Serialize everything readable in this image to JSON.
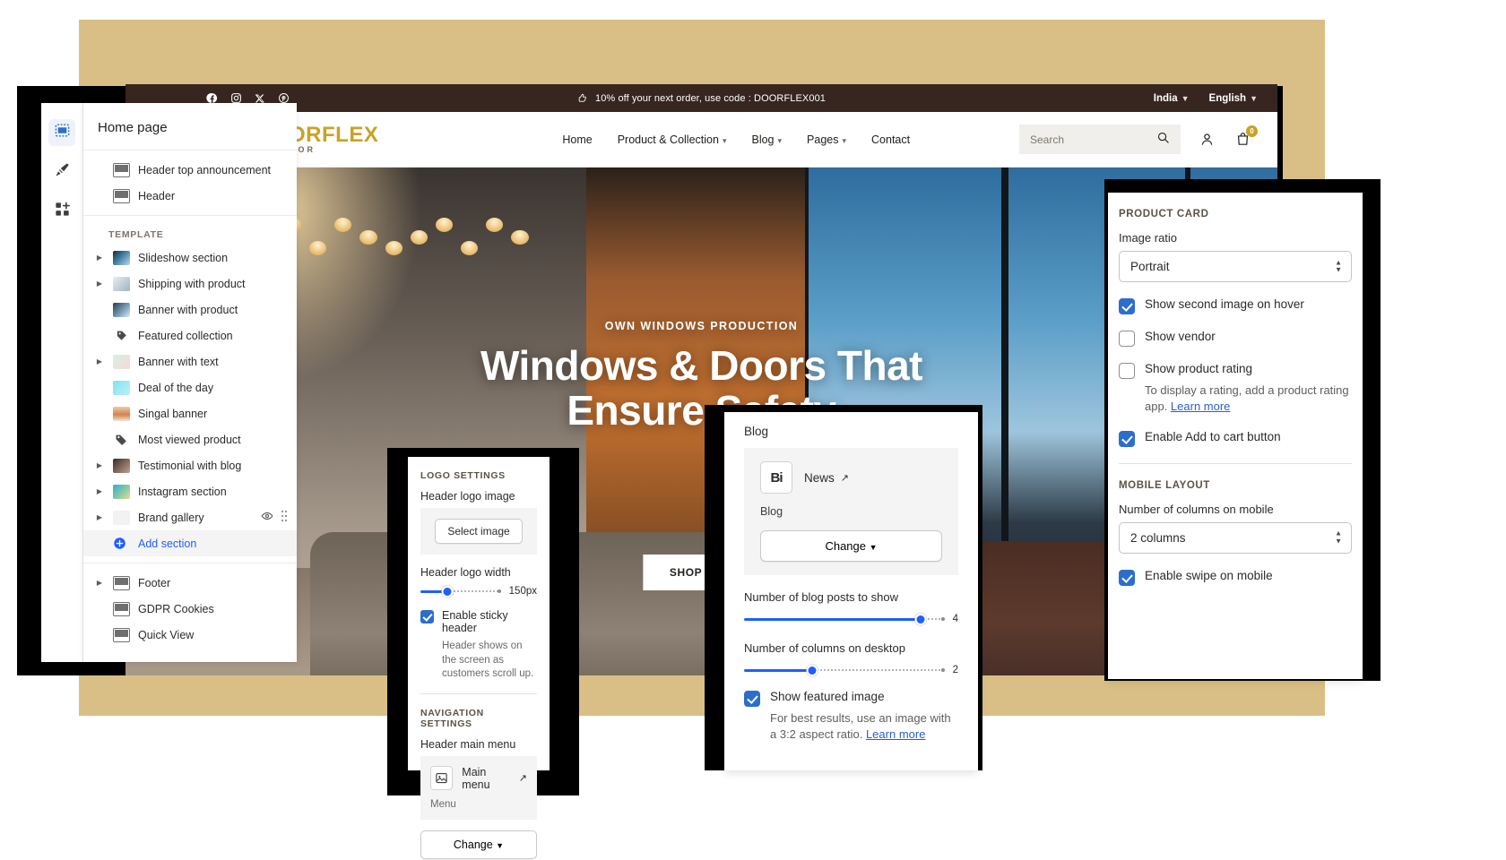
{
  "editor": {
    "rail": [
      {
        "name": "sections-rail-button",
        "icon": "sections-icon",
        "active": true
      },
      {
        "name": "theme-settings-rail-button",
        "icon": "paintbrush-icon",
        "active": false
      },
      {
        "name": "apps-rail-button",
        "icon": "apps-add-icon",
        "active": false
      }
    ],
    "sections_panel": {
      "title": "Home page",
      "header_group": [
        {
          "label": "Header top announcement",
          "thumb": "wire",
          "twisty": false
        },
        {
          "label": "Header",
          "thumb": "wire",
          "twisty": false
        }
      ],
      "template_label": "TEMPLATE",
      "template_items": [
        {
          "label": "Slideshow section",
          "thumb": "t-slide",
          "twisty": true
        },
        {
          "label": "Shipping with product",
          "thumb": "t-ship",
          "twisty": true
        },
        {
          "label": "Banner with product",
          "thumb": "t-bwp",
          "twisty": false
        },
        {
          "label": "Featured collection",
          "thumb": "t-feat",
          "twisty": false
        },
        {
          "label": "Banner with text",
          "thumb": "t-bwt",
          "twisty": true
        },
        {
          "label": "Deal of the day",
          "thumb": "t-deal",
          "twisty": false
        },
        {
          "label": "Singal banner",
          "thumb": "t-sing",
          "twisty": false
        },
        {
          "label": "Most viewed product",
          "thumb": "t-most",
          "twisty": false
        },
        {
          "label": "Testimonial with blog",
          "thumb": "t-test",
          "twisty": true
        },
        {
          "label": "Instagram section",
          "thumb": "t-insta",
          "twisty": true
        },
        {
          "label": "Brand gallery",
          "thumb": "t-brand",
          "twisty": true,
          "eye": true,
          "drag": true
        }
      ],
      "add_section_label": "Add section",
      "footer_items": [
        {
          "label": "Footer",
          "thumb": "wire",
          "twisty": true
        },
        {
          "label": "GDPR Cookies",
          "thumb": "wire",
          "twisty": false
        },
        {
          "label": "Quick View",
          "thumb": "wire",
          "twisty": false
        }
      ]
    }
  },
  "preview": {
    "announcement": {
      "social": [
        "facebook-icon",
        "instagram-icon",
        "x-twitter-icon",
        "pinterest-icon"
      ],
      "message": "10% off your next order, use code : DOORFLEX001",
      "country": "India",
      "language": "English"
    },
    "nav": {
      "brand": "DOORFLEX",
      "brand_sub": "INTERIOR",
      "links": [
        {
          "label": "Home",
          "caret": false
        },
        {
          "label": "Product & Collection",
          "caret": true
        },
        {
          "label": "Blog",
          "caret": true
        },
        {
          "label": "Pages",
          "caret": true
        },
        {
          "label": "Contact",
          "caret": false
        }
      ],
      "search_placeholder": "Search",
      "cart_count": "0"
    },
    "hero": {
      "kicker": "OWN WINDOWS PRODUCTION",
      "title_line1": "Windows & Doors That",
      "title_line2": "Ensure Safety",
      "cta": "SHOP NOW"
    }
  },
  "logo_panel": {
    "section_title": "LOGO SETTINGS",
    "logo_image_label": "Header logo image",
    "select_image_button": "Select image",
    "logo_width_label": "Header logo width",
    "logo_width_value": "150px",
    "logo_width_percent": 33,
    "sticky_header_label": "Enable sticky header",
    "sticky_header_checked": true,
    "sticky_header_helper": "Header shows on the screen as customers scroll up.",
    "nav_section_title": "NAVIGATION SETTINGS",
    "main_menu_label": "Header main menu",
    "main_menu_value": "Main menu",
    "main_menu_sub": "Menu",
    "change_button": "Change"
  },
  "blog_panel": {
    "title": "Blog",
    "ref_thumb": "Bi",
    "ref_name": "News",
    "ref_sub": "Blog",
    "change_button": "Change",
    "posts_label": "Number of blog posts to show",
    "posts_value": "4",
    "posts_percent": 88,
    "columns_label": "Number of columns on desktop",
    "columns_value": "2",
    "columns_percent": 34,
    "featured_label": "Show featured image",
    "featured_checked": true,
    "featured_helper_pre": "For best results, use an image with a 3:2 aspect ratio. ",
    "featured_helper_link": "Learn more"
  },
  "product_card_panel": {
    "section_title": "PRODUCT CARD",
    "image_ratio_label": "Image ratio",
    "image_ratio_value": "Portrait",
    "second_image_label": "Show second image on hover",
    "second_image_checked": true,
    "vendor_label": "Show vendor",
    "vendor_checked": false,
    "rating_label": "Show product rating",
    "rating_checked": false,
    "rating_helper_pre": "To display a rating, add a product rating app. ",
    "rating_helper_link": "Learn more",
    "add_to_cart_label": "Enable Add to cart button",
    "add_to_cart_checked": true,
    "mobile_section_title": "MOBILE LAYOUT",
    "mobile_columns_label": "Number of columns on mobile",
    "mobile_columns_value": "2 columns",
    "swipe_label": "Enable swipe on mobile",
    "swipe_checked": true
  }
}
